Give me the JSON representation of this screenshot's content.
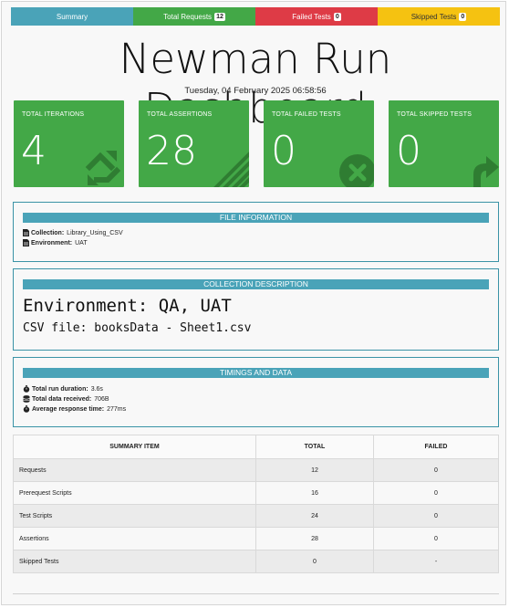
{
  "tabs": [
    {
      "label": "Summary",
      "badge": ""
    },
    {
      "label": "Total Requests",
      "badge": "12"
    },
    {
      "label": "Failed Tests",
      "badge": "0"
    },
    {
      "label": "Skipped Tests",
      "badge": "0"
    }
  ],
  "title": "Newman Run Dashboard",
  "timestamp": "Tuesday, 04 February 2025 06:58:56",
  "cards": [
    {
      "label": "TOTAL ITERATIONS",
      "value": "4",
      "icon": "sync-icon"
    },
    {
      "label": "TOTAL ASSERTIONS",
      "value": "28",
      "icon": "list-icon"
    },
    {
      "label": "TOTAL FAILED TESTS",
      "value": "0",
      "icon": "times-circle-icon"
    },
    {
      "label": "TOTAL SKIPPED TESTS",
      "value": "0",
      "icon": "share-arrow-icon"
    }
  ],
  "file_info": {
    "heading": "FILE INFORMATION",
    "collection_label": "Collection:",
    "collection_value": "Library_Using_CSV",
    "environment_label": "Environment:",
    "environment_value": "UAT"
  },
  "collection_description": {
    "heading": "COLLECTION DESCRIPTION",
    "line1": "Environment: QA, UAT",
    "line2": "CSV file: booksData - Sheet1.csv"
  },
  "timings": {
    "heading": "TIMINGS AND DATA",
    "duration_label": "Total run duration:",
    "duration_value": "3.6s",
    "data_label": "Total data received:",
    "data_value": "706B",
    "response_label": "Average response time:",
    "response_value": "277ms"
  },
  "summary_table": {
    "headers": [
      "SUMMARY ITEM",
      "TOTAL",
      "FAILED"
    ],
    "rows": [
      [
        "Requests",
        "12",
        "0"
      ],
      [
        "Prerequest Scripts",
        "16",
        "0"
      ],
      [
        "Test Scripts",
        "24",
        "0"
      ],
      [
        "Assertions",
        "28",
        "0"
      ],
      [
        "Skipped Tests",
        "0",
        "-"
      ]
    ]
  },
  "colors": {
    "summary": "#4aa3b8",
    "success": "#43a847",
    "danger": "#de3b46",
    "warning": "#f5c211"
  }
}
